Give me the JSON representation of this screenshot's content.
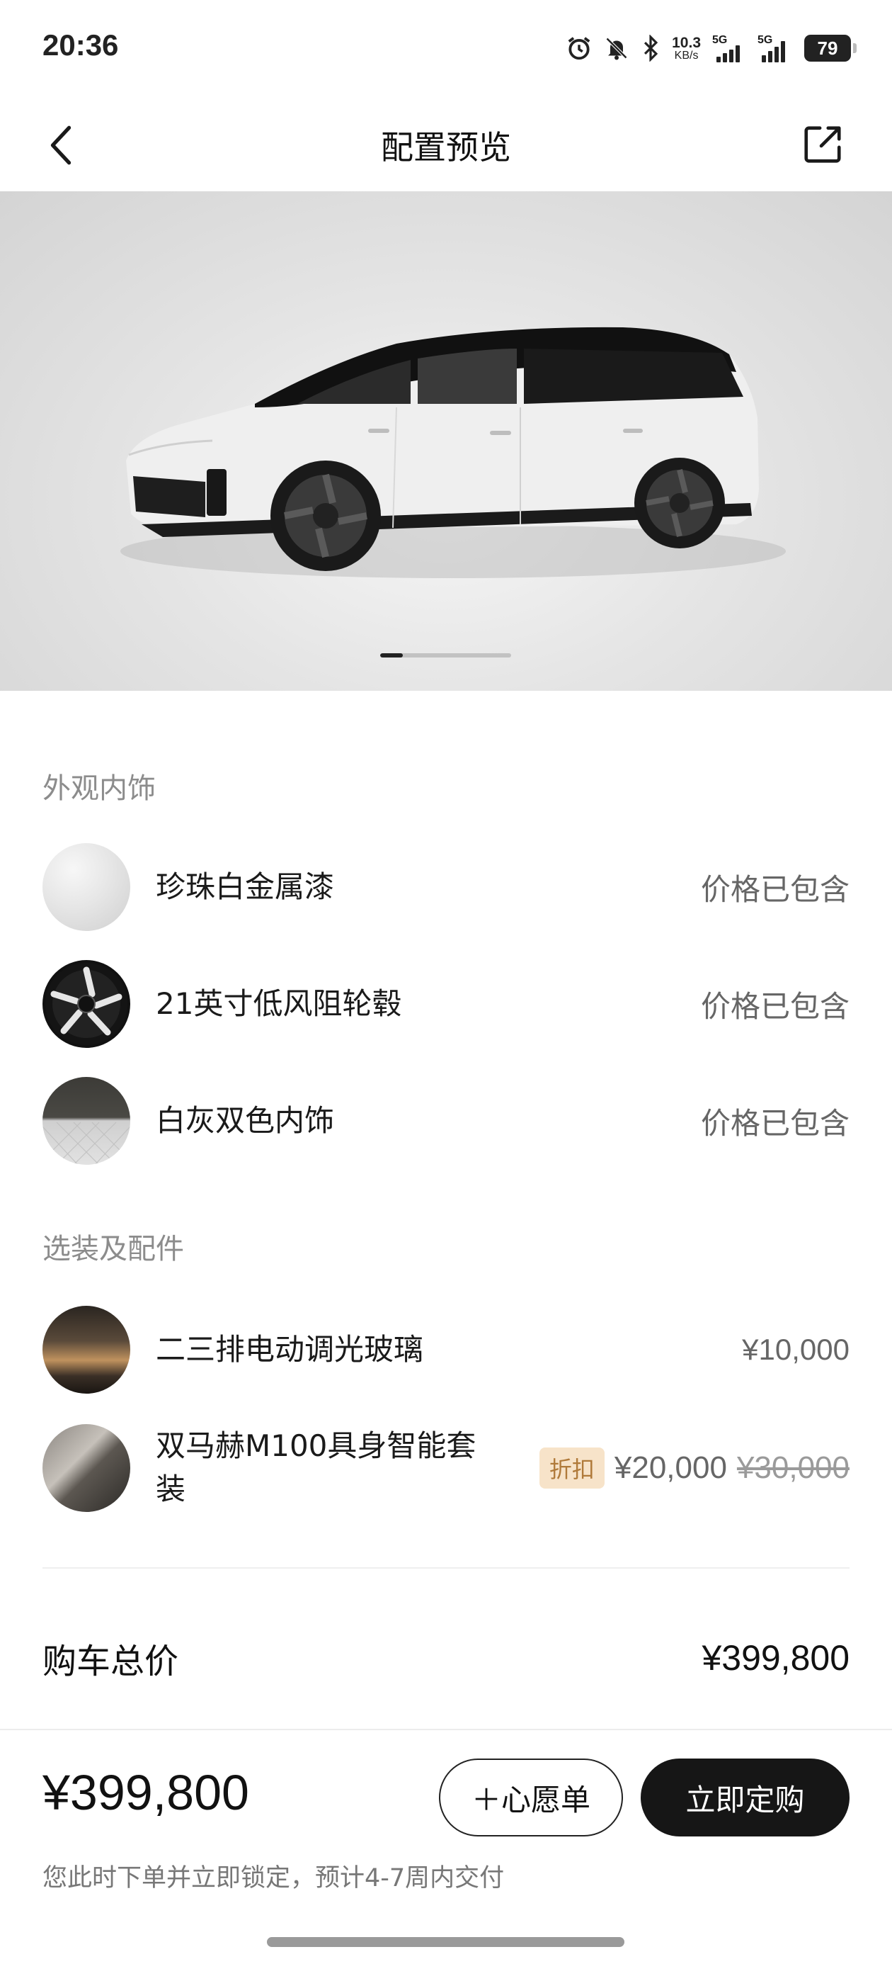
{
  "status_bar": {
    "time": "20:36",
    "net_speed_value": "10.3",
    "net_speed_unit": "KB/s",
    "sim1_label": "5G",
    "sim2_label": "5G",
    "battery": "79",
    "icons": [
      "alarm-icon",
      "mute-bell-icon",
      "bluetooth-icon",
      "signal-icon",
      "signal-icon",
      "battery-icon"
    ]
  },
  "nav": {
    "title": "配置预览",
    "back_icon": "chevron-left-icon",
    "share_icon": "share-icon"
  },
  "hero": {
    "image": "white-black-mpv-car-photo",
    "slide_index": 1
  },
  "exterior_interior": {
    "title": "外观内饰",
    "items": [
      {
        "label": "珍珠白金属漆",
        "price": "价格已包含",
        "thumb": "pearl-white-paint-swatch"
      },
      {
        "label": "21英寸低风阻轮毂",
        "price": "价格已包含",
        "thumb": "wheel-rim-swatch"
      },
      {
        "label": "白灰双色内饰",
        "price": "价格已包含",
        "thumb": "two-tone-interior-swatch"
      }
    ]
  },
  "options": {
    "title": "选装及配件",
    "items": [
      {
        "label": "二三排电动调光玻璃",
        "price": "¥10,000",
        "thumb": "dimming-glass-thumb"
      },
      {
        "label": "双马赫M100具身智能套装",
        "badge": "折扣",
        "price": "¥20,000",
        "original_price": "¥30,000",
        "thumb": "smart-package-thumb"
      }
    ]
  },
  "total": {
    "label": "购车总价",
    "value": "¥399,800"
  },
  "footer": {
    "price": "¥399,800",
    "note": "您此时下单并立即锁定，预计4-7周内交付",
    "wishlist_label": "＋心愿单",
    "order_label": "立即定购"
  },
  "colors": {
    "accent_dark": "#161616",
    "badge_bg": "#f7e3c9",
    "badge_text": "#b07a3a",
    "muted_text": "#8c8c8c"
  }
}
